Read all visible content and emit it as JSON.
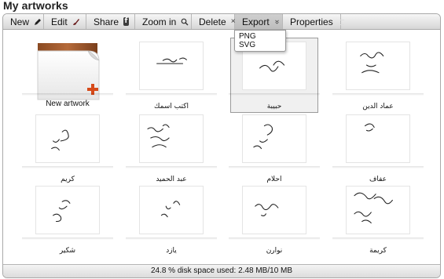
{
  "window": {
    "title": "My artworks"
  },
  "toolbar": {
    "new_label": "New",
    "edit_label": "Edit",
    "share_label": "Share",
    "share_icon_text": "f",
    "zoom_label": "Zoom in",
    "delete_label": "Delete",
    "delete_icon": "×",
    "export_label": "Export",
    "export_chevron": "»",
    "properties_label": "Properties"
  },
  "export_menu": {
    "items": [
      "PNG",
      "SVG"
    ]
  },
  "artworks": [
    {
      "caption": "New artwork",
      "kind": "new"
    },
    {
      "caption": "اكتب اسمك",
      "art": "اكتب اسمك"
    },
    {
      "caption": "حبيبة",
      "art": "حبيبة",
      "selected": true
    },
    {
      "caption": "عماد الدين",
      "art": "عماد الدين"
    },
    {
      "caption": "كريم",
      "art": "كريم"
    },
    {
      "caption": "عبد الحميد",
      "art": "عبد الحميد"
    },
    {
      "caption": "احلام",
      "art": "احلام"
    },
    {
      "caption": "عفاف",
      "art": "عفاف"
    },
    {
      "caption": "شكير",
      "art": "شكير"
    },
    {
      "caption": "يازد",
      "art": "يازد"
    },
    {
      "caption": "نوارن",
      "art": "نوارن"
    },
    {
      "caption": "كريمة",
      "art": "كريمة"
    }
  ],
  "status": {
    "text": "24.8 % disk space used: 2.48 MB/10 MB"
  },
  "colors": {
    "accent": "#d64a1a",
    "toolbar_top": "#f6f6f6",
    "toolbar_bottom": "#d6d6d6"
  }
}
